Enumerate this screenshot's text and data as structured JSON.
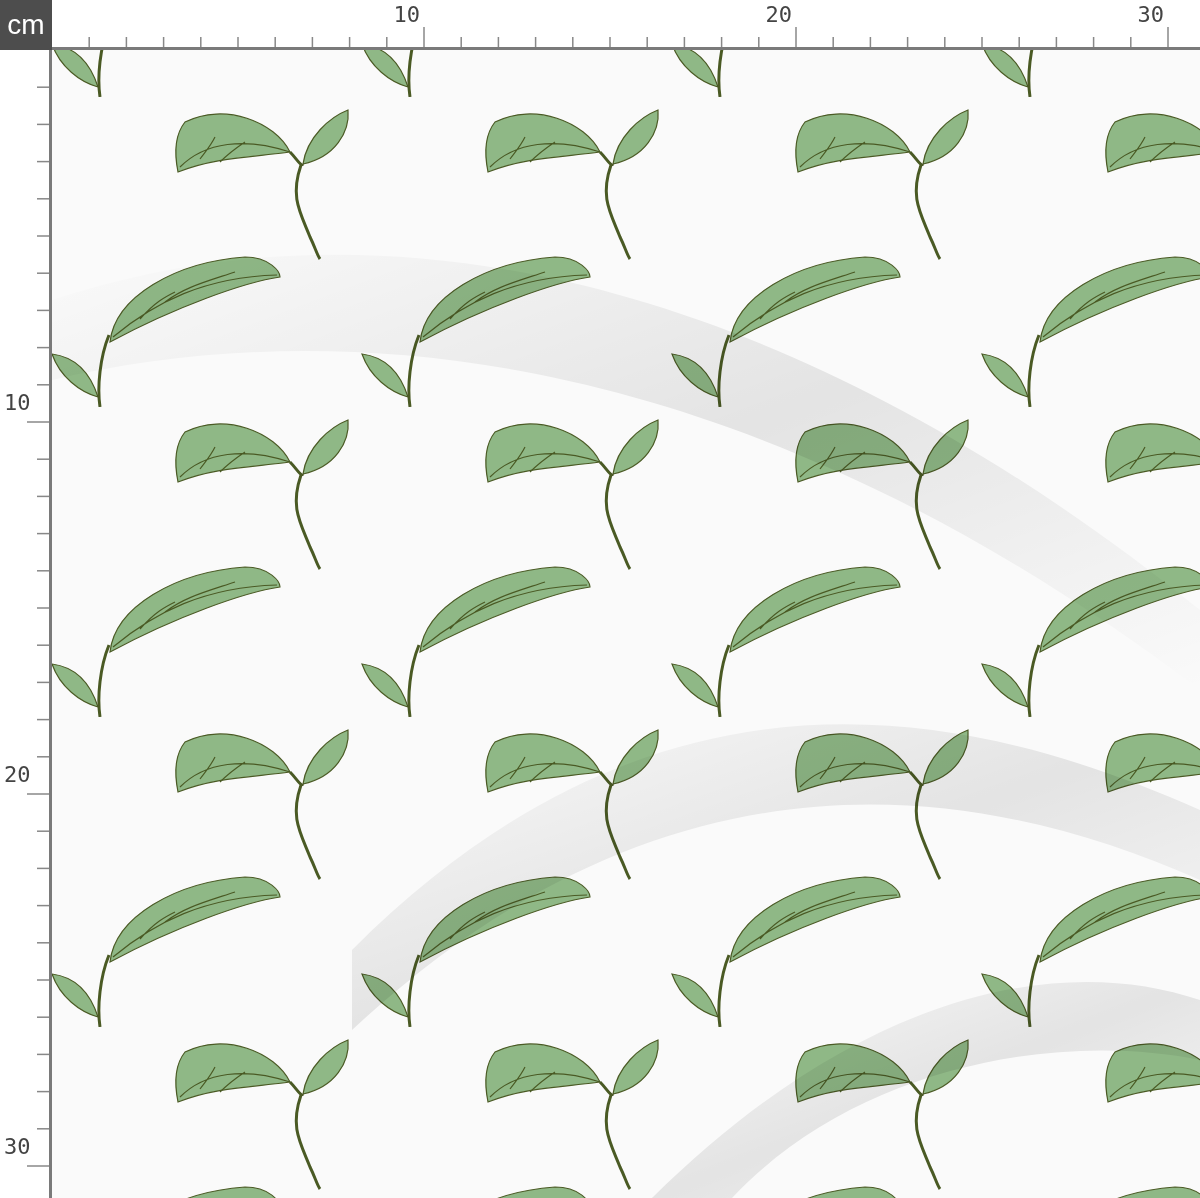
{
  "unit": "cm",
  "top_ruler": {
    "labels": [
      "10",
      "20",
      "30"
    ]
  },
  "left_ruler": {
    "labels": [
      "10",
      "20",
      "30"
    ]
  }
}
